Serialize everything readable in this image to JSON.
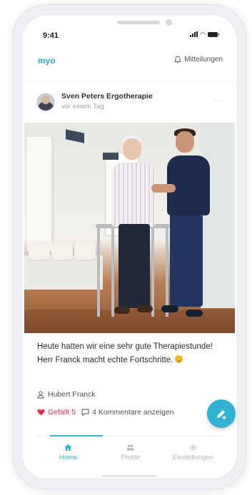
{
  "status_bar": {
    "time": "9:41"
  },
  "header": {
    "app_name": "myo",
    "notifications_label": "Mitteilungen"
  },
  "post": {
    "author": "Sven Peters Ergotherapie",
    "time": "vor einem Tag",
    "more_icon": "ellipsis-icon",
    "caption": "Heute hatten wir eine sehr gute Therapiestunde! Herr Franck macht echte Fortschritte.",
    "caption_emoji": "smiling-face-icon",
    "patient": "Hubert Franck",
    "likes_label": "Gefällt 5",
    "comments_label": "4 Kommentare anzeigen"
  },
  "fab": {
    "icon": "edit-plus-icon"
  },
  "tabs": [
    {
      "label": "Home",
      "icon": "home-icon",
      "active": true
    },
    {
      "label": "Profile",
      "icon": "people-icon",
      "active": false
    },
    {
      "label": "Einstellungen",
      "icon": "gear-icon",
      "active": false
    }
  ],
  "colors": {
    "accent": "#2eb3d3",
    "like": "#e0314f",
    "text": "#2a2e33"
  }
}
